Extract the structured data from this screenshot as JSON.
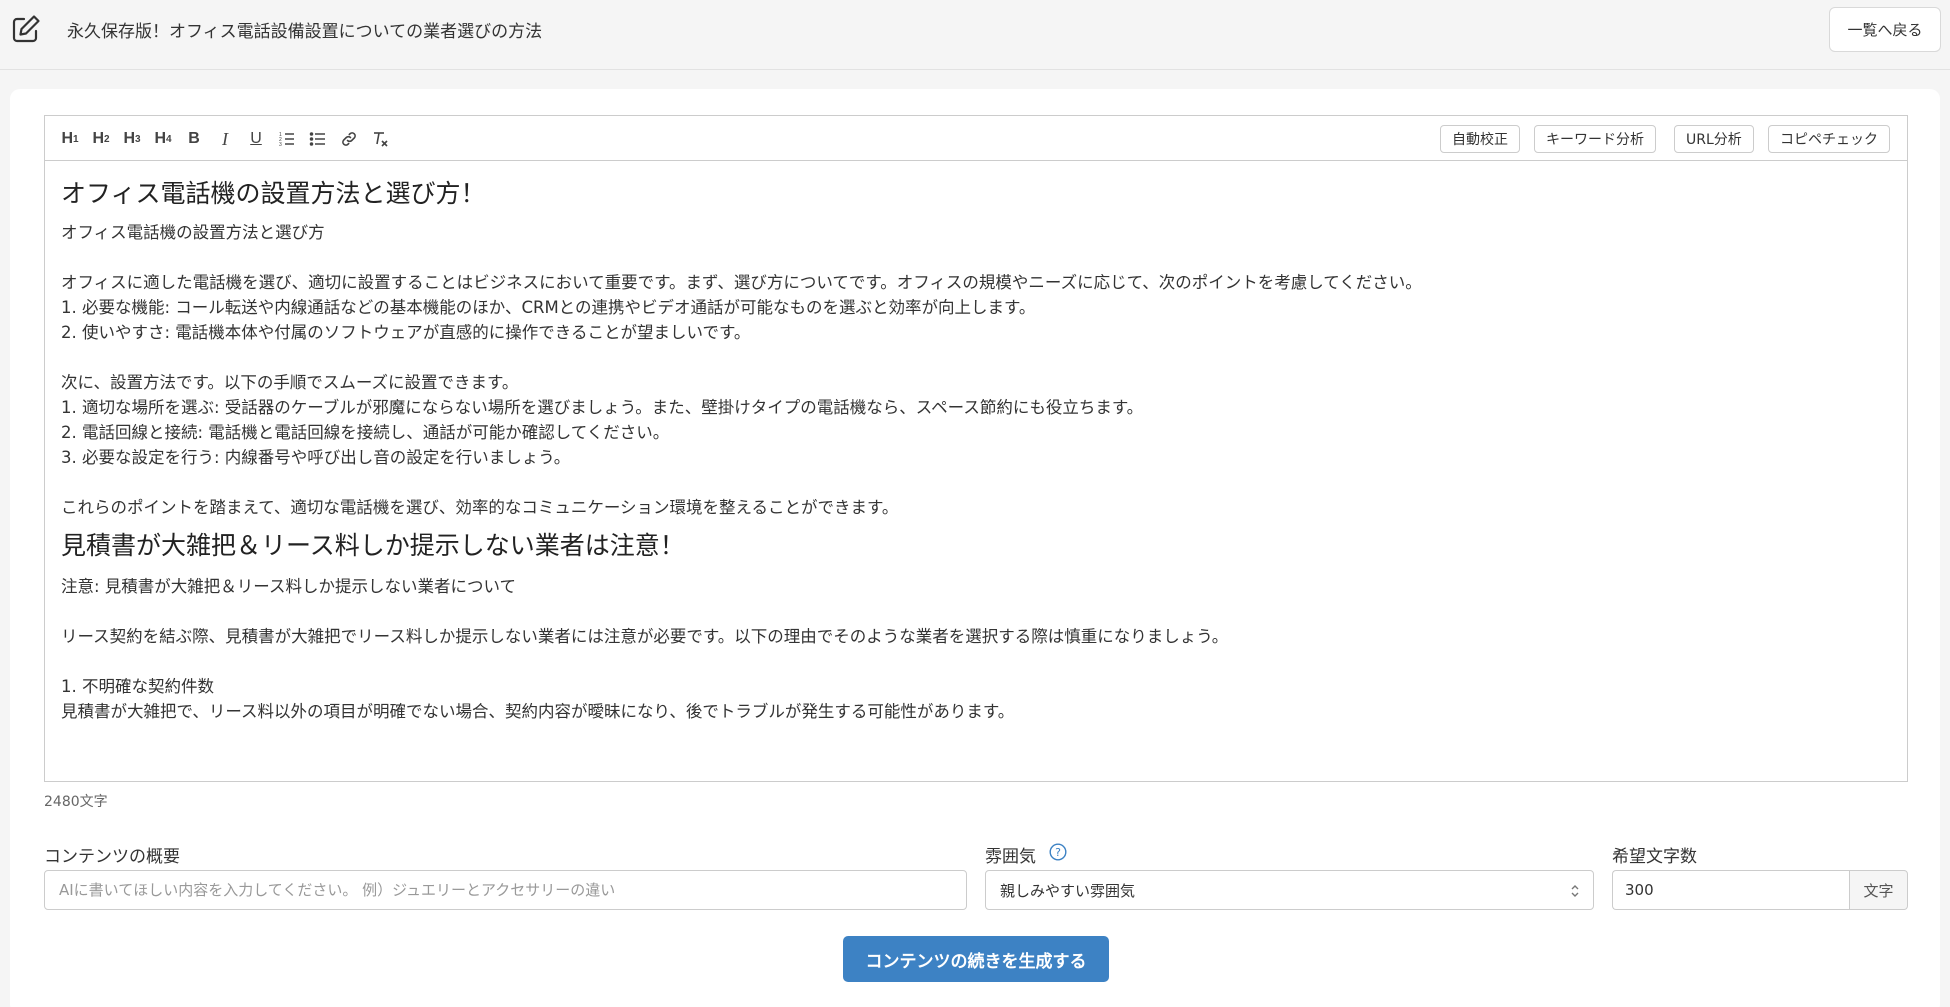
{
  "header": {
    "title": "永久保存版！オフィス電話設備設置についての業者選びの方法",
    "back_label": "一覧へ戻る",
    "edit_icon": "edit-icon"
  },
  "toolbar": {
    "format_buttons": [
      {
        "name": "h1",
        "base": "H",
        "sub": "1"
      },
      {
        "name": "h2",
        "base": "H",
        "sub": "2"
      },
      {
        "name": "h3",
        "base": "H",
        "sub": "3"
      },
      {
        "name": "h4",
        "base": "H",
        "sub": "4"
      },
      {
        "name": "bold",
        "label": "B"
      },
      {
        "name": "italic",
        "label": "I"
      },
      {
        "name": "underline",
        "label": "U"
      },
      {
        "name": "ordered-list",
        "icon": "ordered-list-icon"
      },
      {
        "name": "bullet-list",
        "icon": "bullet-list-icon"
      },
      {
        "name": "link",
        "icon": "link-icon"
      },
      {
        "name": "clear-format",
        "icon": "clear-format-icon"
      }
    ],
    "actions": [
      "自動校正",
      "キーワード分析",
      "URL分析",
      "コピペチェック"
    ]
  },
  "editor": {
    "lines": [
      {
        "type": "h2",
        "text": "オフィス電話機の設置方法と選び方！"
      },
      {
        "type": "p",
        "text": "オフィス電話機の設置方法と選び方"
      },
      {
        "type": "blank",
        "text": ""
      },
      {
        "type": "p",
        "text": "オフィスに適した電話機を選び、適切に設置することはビジネスにおいて重要です。まず、選び方についてです。オフィスの規模やニーズに応じて、次のポイントを考慮してください。"
      },
      {
        "type": "p",
        "text": "1. 必要な機能: コール転送や内線通話などの基本機能のほか、CRMとの連携やビデオ通話が可能なものを選ぶと効率が向上します。"
      },
      {
        "type": "p",
        "text": "2. 使いやすさ: 電話機本体や付属のソフトウェアが直感的に操作できることが望ましいです。"
      },
      {
        "type": "blank",
        "text": ""
      },
      {
        "type": "p",
        "text": "次に、設置方法です。以下の手順でスムーズに設置できます。"
      },
      {
        "type": "p",
        "text": "1. 適切な場所を選ぶ: 受話器のケーブルが邪魔にならない場所を選びましょう。また、壁掛けタイプの電話機なら、スペース節約にも役立ちます。"
      },
      {
        "type": "p",
        "text": "2. 電話回線と接続: 電話機と電話回線を接続し、通話が可能か確認してください。"
      },
      {
        "type": "p",
        "text": "3. 必要な設定を行う: 内線番号や呼び出し音の設定を行いましょう。"
      },
      {
        "type": "blank",
        "text": ""
      },
      {
        "type": "p",
        "text": "これらのポイントを踏まえて、適切な電話機を選び、効率的なコミュニケーション環境を整えることができます。"
      },
      {
        "type": "h2",
        "text": "見積書が大雑把＆リース料しか提示しない業者は注意！"
      },
      {
        "type": "p",
        "text": "注意: 見積書が大雑把＆リース料しか提示しない業者について"
      },
      {
        "type": "blank",
        "text": ""
      },
      {
        "type": "p",
        "text": "リース契約を結ぶ際、見積書が大雑把でリース料しか提示しない業者には注意が必要です。以下の理由でそのような業者を選択する際は慎重になりましょう。"
      },
      {
        "type": "blank",
        "text": ""
      },
      {
        "type": "p",
        "text": "1. 不明確な契約件数"
      },
      {
        "type": "p",
        "text": "見積書が大雑把で、リース料以外の項目が明確でない場合、契約内容が曖昧になり、後でトラブルが発生する可能性があります。"
      }
    ],
    "char_count": "2480文字"
  },
  "form": {
    "summary_label": "コンテンツの概要",
    "summary_placeholder": "AIに書いてほしい内容を入力してください。 例）ジュエリーとアクセサリーの違い",
    "summary_value": "",
    "mood_label": "雰囲気",
    "mood_value": "親しみやすい雰囲気",
    "count_label": "希望文字数",
    "count_value": "300",
    "count_unit": "文字",
    "generate_label": "コンテンツの続きを生成する"
  },
  "colors": {
    "primary": "#3d82c4",
    "background": "#f5f5f5",
    "border": "#cccccc"
  }
}
